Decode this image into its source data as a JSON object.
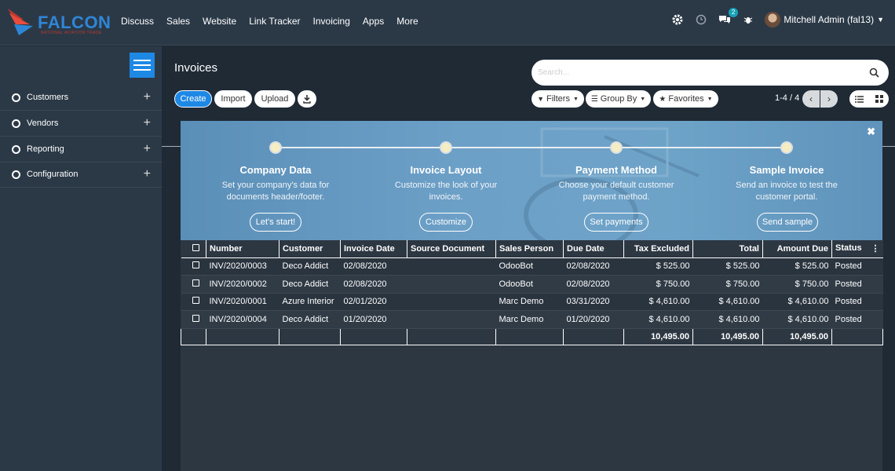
{
  "app": {
    "brand": "FALCON",
    "tagline": "NATIONAL AVIATION TRADE",
    "menu": [
      "Discuss",
      "Sales",
      "Website",
      "Link Tracker",
      "Invoicing",
      "Apps",
      "More"
    ],
    "chat_badge": "2",
    "user": "Mitchell Admin (fal13)"
  },
  "sidebar": {
    "items": [
      {
        "label": "Customers"
      },
      {
        "label": "Vendors"
      },
      {
        "label": "Reporting"
      },
      {
        "label": "Configuration"
      }
    ]
  },
  "control": {
    "title": "Invoices",
    "create": "Create",
    "import": "Import",
    "upload": "Upload",
    "search_placeholder": "Search...",
    "filters": "Filters",
    "group_by": "Group By",
    "favorites": "Favorites",
    "pager": "1-4 / 4"
  },
  "onboarding": {
    "steps": [
      {
        "title": "Company Data",
        "desc": "Set your company's data for documents header/footer.",
        "button": "Let's start!"
      },
      {
        "title": "Invoice Layout",
        "desc": "Customize the look of your invoices.",
        "button": "Customize"
      },
      {
        "title": "Payment Method",
        "desc": "Choose your default customer payment method.",
        "button": "Set payments"
      },
      {
        "title": "Sample Invoice",
        "desc": "Send an invoice to test the customer portal.",
        "button": "Send sample"
      }
    ]
  },
  "table": {
    "headers": {
      "number": "Number",
      "customer": "Customer",
      "invoice_date": "Invoice Date",
      "source": "Source Document",
      "salesperson": "Sales Person",
      "due_date": "Due Date",
      "tax_excluded": "Tax Excluded",
      "total": "Total",
      "amount_due": "Amount Due",
      "status": "Status"
    },
    "rows": [
      {
        "number": "INV/2020/0003",
        "customer": "Deco Addict",
        "invoice_date": "02/08/2020",
        "source": "",
        "salesperson": "OdooBot",
        "due_date": "02/08/2020",
        "tax_excluded": "$ 525.00",
        "total": "$ 525.00",
        "amount_due": "$ 525.00",
        "status": "Posted"
      },
      {
        "number": "INV/2020/0002",
        "customer": "Deco Addict",
        "invoice_date": "02/08/2020",
        "source": "",
        "salesperson": "OdooBot",
        "due_date": "02/08/2020",
        "tax_excluded": "$ 750.00",
        "total": "$ 750.00",
        "amount_due": "$ 750.00",
        "status": "Posted"
      },
      {
        "number": "INV/2020/0001",
        "customer": "Azure Interior",
        "invoice_date": "02/01/2020",
        "source": "",
        "salesperson": "Marc Demo",
        "due_date": "03/31/2020",
        "tax_excluded": "$ 4,610.00",
        "total": "$ 4,610.00",
        "amount_due": "$ 4,610.00",
        "status": "Posted"
      },
      {
        "number": "INV/2020/0004",
        "customer": "Deco Addict",
        "invoice_date": "01/20/2020",
        "source": "",
        "salesperson": "Marc Demo",
        "due_date": "01/20/2020",
        "tax_excluded": "$ 4,610.00",
        "total": "$ 4,610.00",
        "amount_due": "$ 4,610.00",
        "status": "Posted"
      }
    ],
    "totals": {
      "tax_excluded": "10,495.00",
      "total": "10,495.00",
      "amount_due": "10,495.00"
    }
  },
  "colors": {
    "accent": "#1e88e5",
    "brand": "#2f86d6",
    "panel": "#2b3947"
  }
}
